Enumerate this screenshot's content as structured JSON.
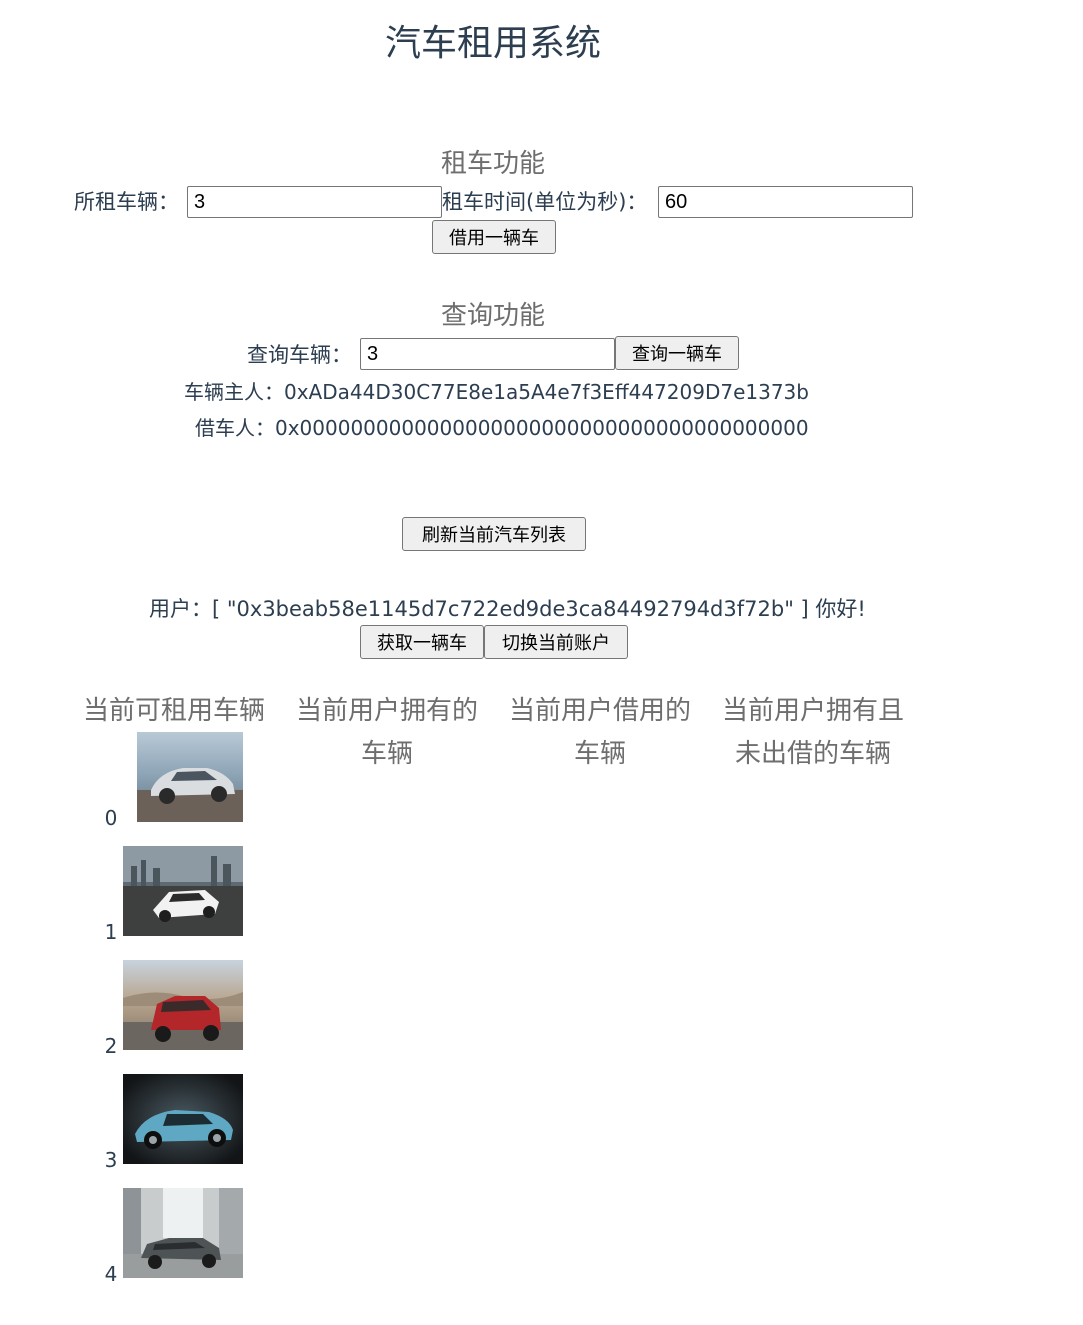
{
  "app": {
    "title": "汽车租用系统"
  },
  "rent": {
    "section_title": "租车功能",
    "car_label": "所租车辆：",
    "car_value": "3",
    "time_label": "租车时间(单位为秒)：",
    "time_value": "60",
    "button": "借用一辆车"
  },
  "query": {
    "section_title": "查询功能",
    "car_label": "查询车辆：",
    "car_value": "3",
    "button": "查询一辆车",
    "owner_label": "车辆主人：",
    "owner_value": "0xADa44D30C77E8e1a5A4e7f3Eff447209D7e1373b",
    "borrower_label": "借车人：",
    "borrower_value": "0x0000000000000000000000000000000000000000"
  },
  "refresh_button": "刷新当前汽车列表",
  "user": {
    "prefix": "用户：",
    "address": "[ \"0x3beab58e1145d7c722ed9de3ca84492794d3f72b\" ]",
    "greeting": "你好!"
  },
  "actions": {
    "get_car": "获取一辆车",
    "switch_account": "切换当前账户"
  },
  "columns": [
    {
      "line1": "当前可租用车辆",
      "line2": ""
    },
    {
      "line1": "当前用户拥有的",
      "line2": "车辆"
    },
    {
      "line1": "当前用户借用的",
      "line2": "车辆"
    },
    {
      "line1": "当前用户拥有且",
      "line2": "未出借的车辆"
    }
  ],
  "cars": [
    {
      "index": "0",
      "image": "silver-sedan-photo"
    },
    {
      "index": "1",
      "image": "white-supercar-photo"
    },
    {
      "index": "2",
      "image": "red-suv-photo"
    },
    {
      "index": "3",
      "image": "blue-concept-car-photo"
    },
    {
      "index": "4",
      "image": "grey-coupe-photo"
    }
  ]
}
